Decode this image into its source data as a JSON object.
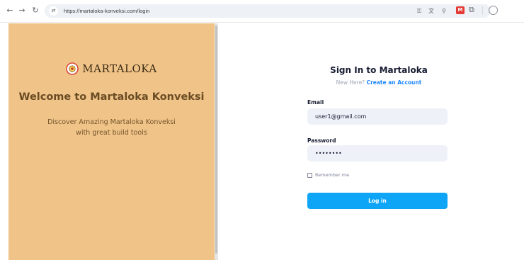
{
  "browser": {
    "url": "https://martaloka-konveksi.com/login",
    "icons": [
      "back-arrow-icon",
      "forward-arrow-icon",
      "reload-icon",
      "site-info-icon",
      "password-key-icon",
      "translate-icon",
      "zoom-icon",
      "bookmark-star-icon",
      "extension-red-icon",
      "extensions-puzzle-icon",
      "profile-icon"
    ]
  },
  "brand": {
    "logo_text": "MARTALOKA",
    "welcome": "Welcome to Martaloka Konveksi",
    "subtitle_line1": "Discover Amazing Martaloka Konveksi",
    "subtitle_line2": "with great build tools",
    "panel_color": "#f0c388"
  },
  "form": {
    "title": "Sign In to Martaloka",
    "new_here": "New Here?",
    "create_account": "Create an Account",
    "email_label": "Email",
    "email_value": "user1@gmail.com",
    "password_label": "Password",
    "password_value": "••••••••",
    "remember_label": "Remember me",
    "login_button": "Log in",
    "accent_color": "#0ea5f7"
  }
}
